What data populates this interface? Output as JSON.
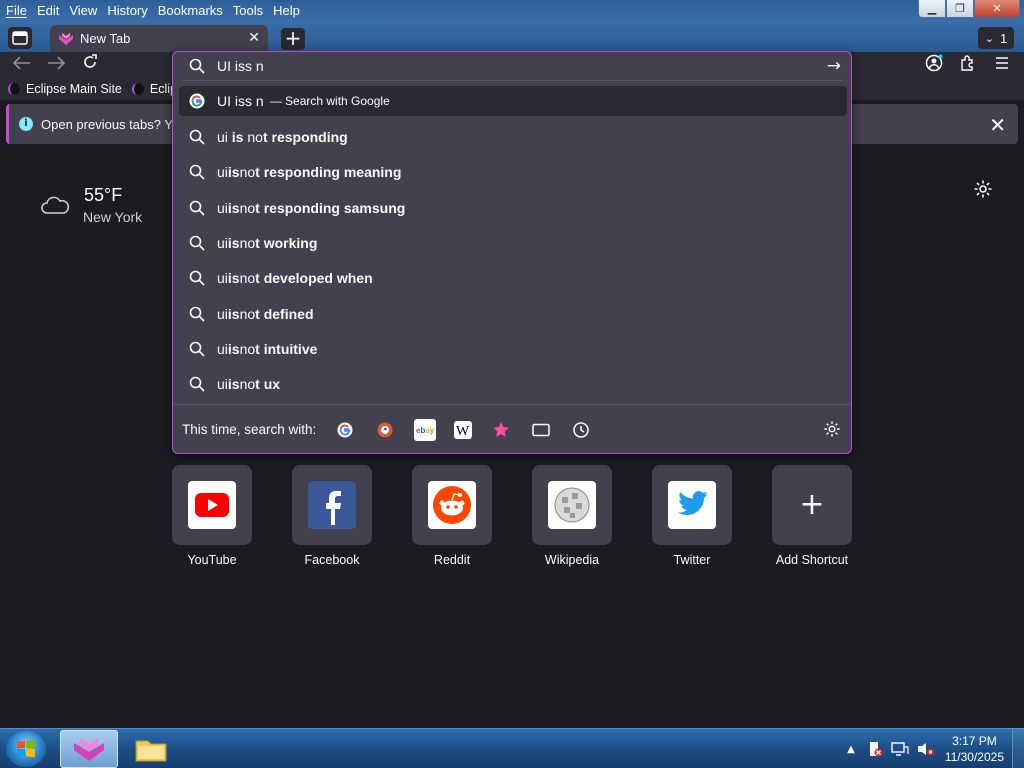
{
  "menubar": {
    "items": [
      "File",
      "Edit",
      "View",
      "History",
      "Bookmarks",
      "Tools",
      "Help"
    ]
  },
  "window_controls": {
    "minimize": "▁",
    "maximize": "❐",
    "close": "✕"
  },
  "tab": {
    "title": "New Tab"
  },
  "tab_count": "1",
  "urlbar": {
    "value": "UI iss n",
    "suggestions": [
      {
        "prefix": "UI iss n",
        "suffix": "— Search with Google",
        "icon": "google-icon"
      },
      {
        "prefix": "ui ",
        "bold1": "is",
        " mid": "",
        "text_nobold": " no",
        "rest": "t responding"
      },
      {
        "plain": "ui ",
        "b": "is",
        "n": " no",
        "t": "t responding meaning"
      },
      {
        "plain": "ui ",
        "b": "is",
        "n": " no",
        "t": "t responding samsung"
      },
      {
        "plain": "ui ",
        "b": "is",
        "n": " no",
        "t": "t working"
      },
      {
        "plain": "ui ",
        "b": "is",
        "n": " no",
        "t": "t developed when"
      },
      {
        "plain": "ui ",
        "b": "is",
        "n": " no",
        "t": "t defined"
      },
      {
        "plain": "ui ",
        "b": "is",
        "n": " no",
        "t": "t intuitive"
      },
      {
        "plain": "ui ",
        "b": "is",
        "n": " no",
        "t": "t ux"
      }
    ],
    "oneoff_label": "This time, search with:"
  },
  "bookmarks": [
    "Eclipse Main Site",
    "Eclips"
  ],
  "notification": {
    "text": "Open previous tabs? You"
  },
  "weather": {
    "temp": "55°F",
    "city": "New York"
  },
  "shortcuts": [
    "YouTube",
    "Facebook",
    "Reddit",
    "Wikipedia",
    "Twitter",
    "Add Shortcut"
  ],
  "clock": {
    "time": "3:17 PM",
    "date": "11/30/2025"
  },
  "colors": {
    "accent": "#c14bd6",
    "panel": "#42414d",
    "page": "#1c1b22",
    "toolbar": "#2b2a33"
  }
}
